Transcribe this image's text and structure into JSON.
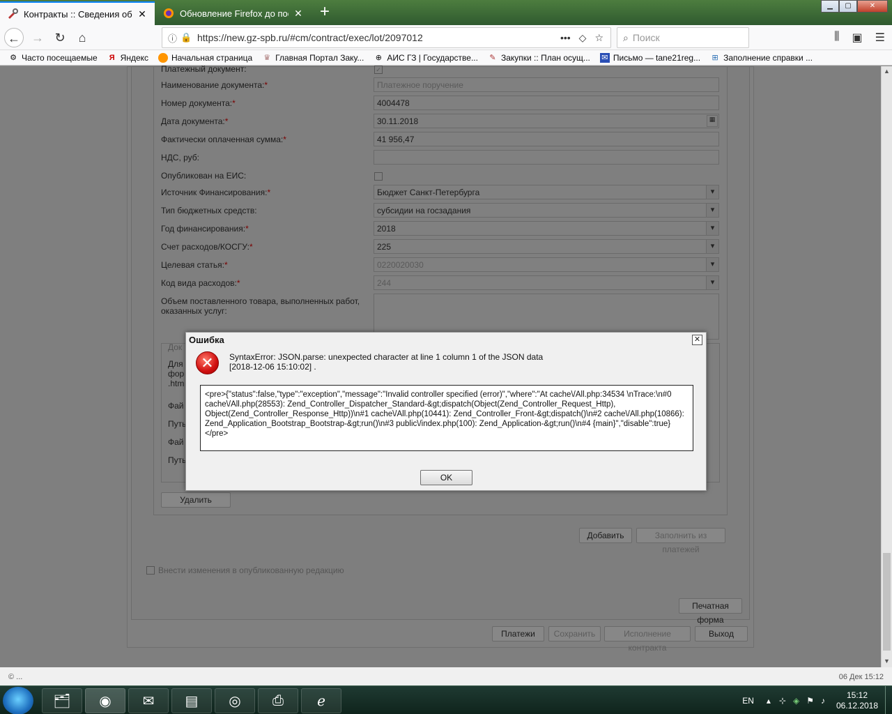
{
  "browser": {
    "tabs": [
      {
        "title": "Контракты :: Сведения об исп",
        "active": true
      },
      {
        "title": "Обновление Firefox до послед",
        "active": false
      }
    ],
    "url": "https://new.gz-spb.ru/#cm/contract/exec/lot/2097012",
    "search_placeholder": "Поиск",
    "bookmarks": [
      {
        "label": "Часто посещаемые",
        "icon": "gear-icon"
      },
      {
        "label": "Яндекс",
        "icon": "yandex-icon"
      },
      {
        "label": "Начальная страница",
        "icon": "firefox-icon"
      },
      {
        "label": "Главная Портал Заку...",
        "icon": "emblem-icon"
      },
      {
        "label": "АИС ГЗ | Государстве...",
        "icon": "globe-icon"
      },
      {
        "label": "Закупки :: План осущ...",
        "icon": "tools-icon"
      },
      {
        "label": "Письмо — tane21reg...",
        "icon": "mail-icon"
      },
      {
        "label": "Заполнение справки ...",
        "icon": "doc-icon"
      }
    ]
  },
  "form": {
    "fields": [
      {
        "label": "Платежный документ:",
        "required": true,
        "type": "checkbox",
        "value": "",
        "checked": true
      },
      {
        "label": "Наименование документа:",
        "required": true,
        "type": "text",
        "value": "Платежное поручение",
        "disabled": true
      },
      {
        "label": "Номер документа:",
        "required": true,
        "type": "text",
        "value": "4004478"
      },
      {
        "label": "Дата документа:",
        "required": true,
        "type": "date",
        "value": "30.11.2018"
      },
      {
        "label": "Фактически оплаченная сумма:",
        "required": true,
        "type": "text",
        "value": "41 956,47"
      },
      {
        "label": "НДС, руб:",
        "required": false,
        "type": "text",
        "value": ""
      },
      {
        "label": "Опубликован на ЕИС:",
        "required": false,
        "type": "checkbox",
        "value": "",
        "checked": false
      },
      {
        "label": "Источник Финансирования:",
        "required": true,
        "type": "select",
        "value": "Бюджет Санкт-Петербурга"
      },
      {
        "label": "Тип бюджетных средств:",
        "required": false,
        "type": "select",
        "value": "субсидии на госзадания"
      },
      {
        "label": "Год финансирования:",
        "required": true,
        "type": "select",
        "value": "2018"
      },
      {
        "label": "Счет расходов/КОСГУ:",
        "required": true,
        "type": "select",
        "value": "225"
      },
      {
        "label": "Целевая статья:",
        "required": true,
        "type": "select",
        "value": "0220020030",
        "disabled": true
      },
      {
        "label": "Код вида расходов:",
        "required": true,
        "type": "select",
        "value": "244",
        "disabled": true
      },
      {
        "label": "Объем поставленного товара, выполненных работ, оказанных услуг:",
        "required": false,
        "type": "textarea",
        "value": ""
      }
    ],
    "doc_fragments": [
      "Док",
      "Для",
      "фор",
      ".htm",
      "Фай",
      "Путь",
      "Фай",
      "Путь"
    ],
    "buttons": {
      "delete": "Удалить",
      "add": "Добавить",
      "fill_from_payments": "Заполнить из платежей",
      "print_form": "Печатная форма",
      "payments": "Платежи",
      "save": "Сохранить",
      "contract_execution": "Исполнение контракта",
      "exit": "Выход"
    },
    "publish_changes_label": "Внести изменения в опубликованную редакцию"
  },
  "dialog": {
    "title": "Ошибка",
    "message": "SyntaxError: JSON.parse: unexpected character at line 1 column 1 of the JSON data",
    "timestamp": "[2018-12-06 15:10:02] .",
    "detail": "<pre>{\"status\":false,\"type\":\"exception\",\"message\":\"Invalid controller specified (error)\",\"where\":\"At cache\\/All.php:34534 \\nTrace:\\n#0 cache\\/All.php(28553): Zend_Controller_Dispatcher_Standard-&gt;dispatch(Object(Zend_Controller_Request_Http), Object(Zend_Controller_Response_Http))\\n#1 cache\\/All.php(10441): Zend_Controller_Front-&gt;dispatch()\\n#2 cache\\/All.php(10866): Zend_Application_Bootstrap_Bootstrap-&gt;run()\\n#3 public\\/index.php(100): Zend_Application-&gt;run()\\n#4 {main}\",\"disable\":true}</pre>",
    "ok_label": "OK"
  },
  "statusbar": {
    "left": "© ...",
    "right": "06 Дек 15:12"
  },
  "taskbar": {
    "lang": "EN",
    "time": "15:12",
    "date": "06.12.2018",
    "apps": [
      "explorer-icon",
      "firefox-icon",
      "outlook-icon",
      "folders-icon",
      "chrome-icon",
      "fax-icon",
      "ie-icon"
    ]
  },
  "colors": {
    "accent": "#0a84ff",
    "required": "#cc0000",
    "error": "#d01010"
  }
}
